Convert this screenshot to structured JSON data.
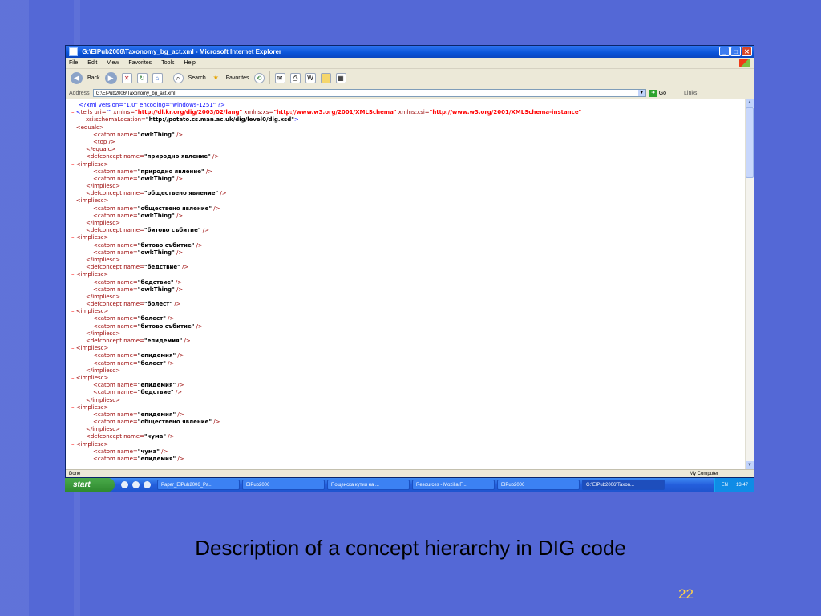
{
  "window": {
    "title": "G:\\ElPub2006\\Taxonomy_bg_act.xml - Microsoft Internet Explorer",
    "min_glyph": "_",
    "max_glyph": "□",
    "close_glyph": "✕"
  },
  "menu": [
    "File",
    "Edit",
    "View",
    "Favorites",
    "Tools",
    "Help"
  ],
  "toolbar": {
    "back_label": "Back",
    "search_label": "Search",
    "favorites_label": "Favorites"
  },
  "address": {
    "label": "Address",
    "value": "G:\\ElPub2006\\Taxonomy_bg_act.xml",
    "go_label": "Go",
    "links_label": "Links"
  },
  "xml_lines": [
    {
      "indent": 0,
      "minus": false,
      "parts": [
        {
          "t": "<?xml version=\"1.0\" encoding=\"windows-1251\" ?>",
          "c": "#0000FF"
        }
      ]
    },
    {
      "indent": 0,
      "minus": true,
      "parts": [
        {
          "t": "<",
          "c": "#0000FF"
        },
        {
          "t": "tells",
          "c": "#990000"
        },
        {
          "t": " uri=",
          "c": "#990000"
        },
        {
          "t": "\"\"",
          "c": "#0000FF"
        },
        {
          "t": " xmlns=",
          "c": "#990000"
        },
        {
          "t": "\"http://dl.kr.org/dig/2003/02/lang\"",
          "c": "#FF0000",
          "b": true
        },
        {
          "t": " xmlns:xs=",
          "c": "#990000"
        },
        {
          "t": "\"http://www.w3.org/2001/XMLSchema\"",
          "c": "#FF0000",
          "b": true
        },
        {
          "t": " xmlns:xsi=",
          "c": "#990000"
        },
        {
          "t": "\"http://www.w3.org/2001/XMLSchema-instance\"",
          "c": "#FF0000",
          "b": true
        }
      ]
    },
    {
      "indent": 1,
      "minus": false,
      "parts": [
        {
          "t": "xsi:schemaLocation=",
          "c": "#990000"
        },
        {
          "t": "\"http://potato.cs.man.ac.uk/dig/level0/dig.xsd\"",
          "c": "#000000",
          "b": true
        },
        {
          "t": ">",
          "c": "#0000FF"
        }
      ]
    },
    {
      "indent": 0,
      "minus": true,
      "parts": [
        {
          "t": "<equalc>",
          "c": "#990000"
        }
      ]
    },
    {
      "indent": 2,
      "minus": false,
      "parts": [
        {
          "t": "<catom name=",
          "c": "#990000"
        },
        {
          "t": "\"owl:Thing\"",
          "c": "#000000",
          "b": true
        },
        {
          "t": " />",
          "c": "#990000"
        }
      ]
    },
    {
      "indent": 2,
      "minus": false,
      "parts": [
        {
          "t": "<top />",
          "c": "#990000"
        }
      ]
    },
    {
      "indent": 1,
      "minus": false,
      "parts": [
        {
          "t": "</equalc>",
          "c": "#990000"
        }
      ]
    },
    {
      "indent": 1,
      "minus": false,
      "parts": [
        {
          "t": "<defconcept name=",
          "c": "#990000"
        },
        {
          "t": "\"природно явление\"",
          "c": "#000000",
          "b": true
        },
        {
          "t": " />",
          "c": "#990000"
        }
      ]
    },
    {
      "indent": 0,
      "minus": true,
      "parts": [
        {
          "t": "<impliesc>",
          "c": "#990000"
        }
      ]
    },
    {
      "indent": 2,
      "minus": false,
      "parts": [
        {
          "t": "<catom name=",
          "c": "#990000"
        },
        {
          "t": "\"природно явление\"",
          "c": "#000000",
          "b": true
        },
        {
          "t": " />",
          "c": "#990000"
        }
      ]
    },
    {
      "indent": 2,
      "minus": false,
      "parts": [
        {
          "t": "<catom name=",
          "c": "#990000"
        },
        {
          "t": "\"owl:Thing\"",
          "c": "#000000",
          "b": true
        },
        {
          "t": " />",
          "c": "#990000"
        }
      ]
    },
    {
      "indent": 1,
      "minus": false,
      "parts": [
        {
          "t": "</impliesc>",
          "c": "#990000"
        }
      ]
    },
    {
      "indent": 1,
      "minus": false,
      "parts": [
        {
          "t": "<defconcept name=",
          "c": "#990000"
        },
        {
          "t": "\"обществено явление\"",
          "c": "#000000",
          "b": true
        },
        {
          "t": " />",
          "c": "#990000"
        }
      ]
    },
    {
      "indent": 0,
      "minus": true,
      "parts": [
        {
          "t": "<impliesc>",
          "c": "#990000"
        }
      ]
    },
    {
      "indent": 2,
      "minus": false,
      "parts": [
        {
          "t": "<catom name=",
          "c": "#990000"
        },
        {
          "t": "\"обществено явление\"",
          "c": "#000000",
          "b": true
        },
        {
          "t": " />",
          "c": "#990000"
        }
      ]
    },
    {
      "indent": 2,
      "minus": false,
      "parts": [
        {
          "t": "<catom name=",
          "c": "#990000"
        },
        {
          "t": "\"owl:Thing\"",
          "c": "#000000",
          "b": true
        },
        {
          "t": " />",
          "c": "#990000"
        }
      ]
    },
    {
      "indent": 1,
      "minus": false,
      "parts": [
        {
          "t": "</impliesc>",
          "c": "#990000"
        }
      ]
    },
    {
      "indent": 1,
      "minus": false,
      "parts": [
        {
          "t": "<defconcept name=",
          "c": "#990000"
        },
        {
          "t": "\"битово събитие\"",
          "c": "#000000",
          "b": true
        },
        {
          "t": " />",
          "c": "#990000"
        }
      ]
    },
    {
      "indent": 0,
      "minus": true,
      "parts": [
        {
          "t": "<impliesc>",
          "c": "#990000"
        }
      ]
    },
    {
      "indent": 2,
      "minus": false,
      "parts": [
        {
          "t": "<catom name=",
          "c": "#990000"
        },
        {
          "t": "\"битово събитие\"",
          "c": "#000000",
          "b": true
        },
        {
          "t": " />",
          "c": "#990000"
        }
      ]
    },
    {
      "indent": 2,
      "minus": false,
      "parts": [
        {
          "t": "<catom name=",
          "c": "#990000"
        },
        {
          "t": "\"owl:Thing\"",
          "c": "#000000",
          "b": true
        },
        {
          "t": " />",
          "c": "#990000"
        }
      ]
    },
    {
      "indent": 1,
      "minus": false,
      "parts": [
        {
          "t": "</impliesc>",
          "c": "#990000"
        }
      ]
    },
    {
      "indent": 1,
      "minus": false,
      "parts": [
        {
          "t": "<defconcept name=",
          "c": "#990000"
        },
        {
          "t": "\"бедствие\"",
          "c": "#000000",
          "b": true
        },
        {
          "t": " />",
          "c": "#990000"
        }
      ]
    },
    {
      "indent": 0,
      "minus": true,
      "parts": [
        {
          "t": "<impliesc>",
          "c": "#990000"
        }
      ]
    },
    {
      "indent": 2,
      "minus": false,
      "parts": [
        {
          "t": "<catom name=",
          "c": "#990000"
        },
        {
          "t": "\"бедствие\"",
          "c": "#000000",
          "b": true
        },
        {
          "t": " />",
          "c": "#990000"
        }
      ]
    },
    {
      "indent": 2,
      "minus": false,
      "parts": [
        {
          "t": "<catom name=",
          "c": "#990000"
        },
        {
          "t": "\"owl:Thing\"",
          "c": "#000000",
          "b": true
        },
        {
          "t": " />",
          "c": "#990000"
        }
      ]
    },
    {
      "indent": 1,
      "minus": false,
      "parts": [
        {
          "t": "</impliesc>",
          "c": "#990000"
        }
      ]
    },
    {
      "indent": 1,
      "minus": false,
      "parts": [
        {
          "t": "<defconcept name=",
          "c": "#990000"
        },
        {
          "t": "\"болест\"",
          "c": "#000000",
          "b": true
        },
        {
          "t": " />",
          "c": "#990000"
        }
      ]
    },
    {
      "indent": 0,
      "minus": true,
      "parts": [
        {
          "t": "<impliesc>",
          "c": "#990000"
        }
      ]
    },
    {
      "indent": 2,
      "minus": false,
      "parts": [
        {
          "t": "<catom name=",
          "c": "#990000"
        },
        {
          "t": "\"болест\"",
          "c": "#000000",
          "b": true
        },
        {
          "t": " />",
          "c": "#990000"
        }
      ]
    },
    {
      "indent": 2,
      "minus": false,
      "parts": [
        {
          "t": "<catom name=",
          "c": "#990000"
        },
        {
          "t": "\"битово събитие\"",
          "c": "#000000",
          "b": true
        },
        {
          "t": " />",
          "c": "#990000"
        }
      ]
    },
    {
      "indent": 1,
      "minus": false,
      "parts": [
        {
          "t": "</impliesc>",
          "c": "#990000"
        }
      ]
    },
    {
      "indent": 1,
      "minus": false,
      "parts": [
        {
          "t": "<defconcept name=",
          "c": "#990000"
        },
        {
          "t": "\"епидемия\"",
          "c": "#000000",
          "b": true
        },
        {
          "t": " />",
          "c": "#990000"
        }
      ]
    },
    {
      "indent": 0,
      "minus": true,
      "parts": [
        {
          "t": "<impliesc>",
          "c": "#990000"
        }
      ]
    },
    {
      "indent": 2,
      "minus": false,
      "parts": [
        {
          "t": "<catom name=",
          "c": "#990000"
        },
        {
          "t": "\"епидемия\"",
          "c": "#000000",
          "b": true
        },
        {
          "t": " />",
          "c": "#990000"
        }
      ]
    },
    {
      "indent": 2,
      "minus": false,
      "parts": [
        {
          "t": "<catom name=",
          "c": "#990000"
        },
        {
          "t": "\"болест\"",
          "c": "#000000",
          "b": true
        },
        {
          "t": " />",
          "c": "#990000"
        }
      ]
    },
    {
      "indent": 1,
      "minus": false,
      "parts": [
        {
          "t": "</impliesc>",
          "c": "#990000"
        }
      ]
    },
    {
      "indent": 0,
      "minus": true,
      "parts": [
        {
          "t": "<impliesc>",
          "c": "#990000"
        }
      ]
    },
    {
      "indent": 2,
      "minus": false,
      "parts": [
        {
          "t": "<catom name=",
          "c": "#990000"
        },
        {
          "t": "\"епидемия\"",
          "c": "#000000",
          "b": true
        },
        {
          "t": " />",
          "c": "#990000"
        }
      ]
    },
    {
      "indent": 2,
      "minus": false,
      "parts": [
        {
          "t": "<catom name=",
          "c": "#990000"
        },
        {
          "t": "\"бедствие\"",
          "c": "#000000",
          "b": true
        },
        {
          "t": " />",
          "c": "#990000"
        }
      ]
    },
    {
      "indent": 1,
      "minus": false,
      "parts": [
        {
          "t": "</impliesc>",
          "c": "#990000"
        }
      ]
    },
    {
      "indent": 0,
      "minus": true,
      "parts": [
        {
          "t": "<impliesc>",
          "c": "#990000"
        }
      ]
    },
    {
      "indent": 2,
      "minus": false,
      "parts": [
        {
          "t": "<catom name=",
          "c": "#990000"
        },
        {
          "t": "\"епидемия\"",
          "c": "#000000",
          "b": true
        },
        {
          "t": " />",
          "c": "#990000"
        }
      ]
    },
    {
      "indent": 2,
      "minus": false,
      "parts": [
        {
          "t": "<catom name=",
          "c": "#990000"
        },
        {
          "t": "\"обществено явление\"",
          "c": "#000000",
          "b": true
        },
        {
          "t": " />",
          "c": "#990000"
        }
      ]
    },
    {
      "indent": 1,
      "minus": false,
      "parts": [
        {
          "t": "</impliesc>",
          "c": "#990000"
        }
      ]
    },
    {
      "indent": 1,
      "minus": false,
      "parts": [
        {
          "t": "<defconcept name=",
          "c": "#990000"
        },
        {
          "t": "\"чума\"",
          "c": "#000000",
          "b": true
        },
        {
          "t": " />",
          "c": "#990000"
        }
      ]
    },
    {
      "indent": 0,
      "minus": true,
      "parts": [
        {
          "t": "<impliesc>",
          "c": "#990000"
        }
      ]
    },
    {
      "indent": 2,
      "minus": false,
      "parts": [
        {
          "t": "<catom name=",
          "c": "#990000"
        },
        {
          "t": "\"чума\"",
          "c": "#000000",
          "b": true
        },
        {
          "t": " />",
          "c": "#990000"
        }
      ]
    },
    {
      "indent": 2,
      "minus": false,
      "parts": [
        {
          "t": "<catom name=",
          "c": "#990000"
        },
        {
          "t": "\"епидемия\"",
          "c": "#000000",
          "b": true
        },
        {
          "t": " />",
          "c": "#990000"
        }
      ]
    }
  ],
  "status": {
    "left": "Done",
    "zone": "My Computer"
  },
  "taskbar": {
    "start_label": "start",
    "tasks": [
      "Paper_ElPub2006_Pa...",
      "ElPub2006",
      "Пощенска кутия на ...",
      "Resources - Mozilla Fi...",
      "ElPub2006",
      "G:\\ElPub2006\\Taxon..."
    ],
    "lang": "EN",
    "clock": "13:47"
  },
  "slide": {
    "caption": "Description of a concept hierarchy in DIG code",
    "page_number": "22"
  }
}
